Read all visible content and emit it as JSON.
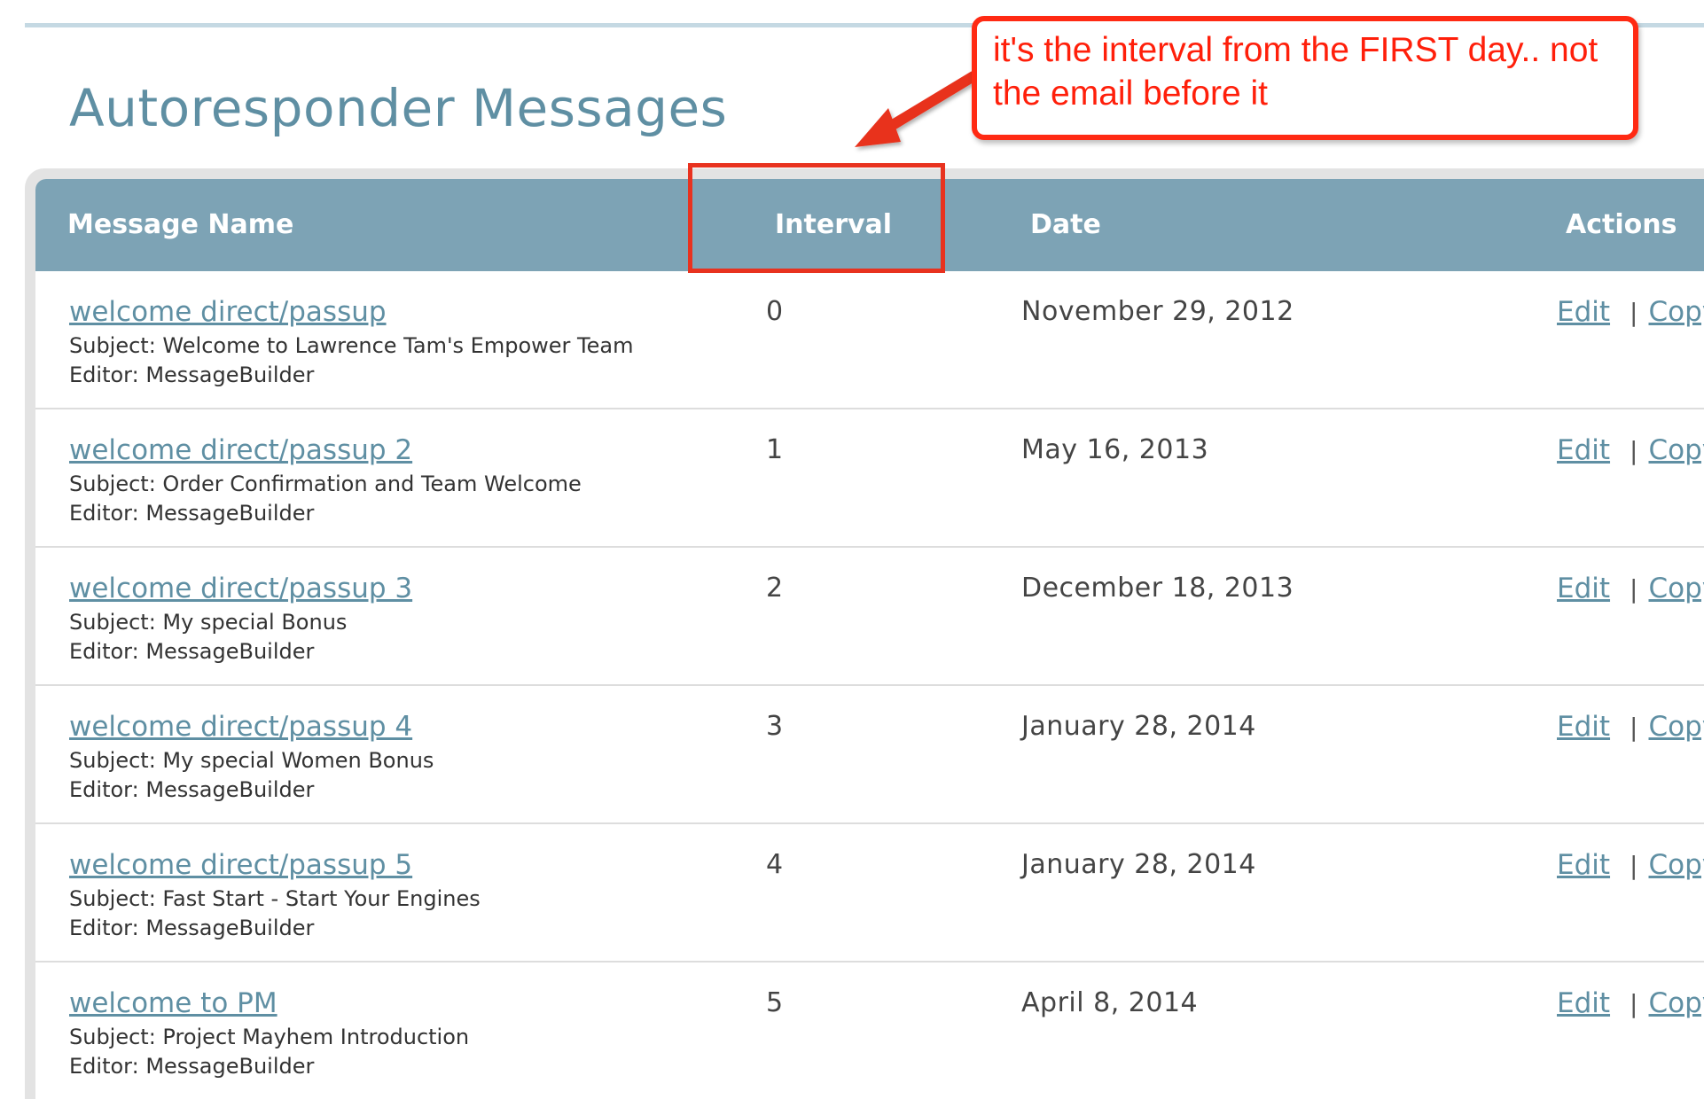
{
  "page": {
    "title": "Autoresponder Messages"
  },
  "table": {
    "headers": {
      "name": "Message Name",
      "interval": "Interval",
      "date": "Date",
      "actions": "Actions"
    },
    "action_labels": {
      "edit": "Edit",
      "separator": "|",
      "copy": "Copy"
    },
    "rows": [
      {
        "name": "welcome direct/passup",
        "subject": "Subject: Welcome to Lawrence Tam's Empower Team",
        "editor": "Editor: MessageBuilder",
        "interval": "0",
        "date": "November 29, 2012"
      },
      {
        "name": "welcome direct/passup 2",
        "subject": "Subject: Order Confirmation and Team Welcome",
        "editor": "Editor: MessageBuilder",
        "interval": "1",
        "date": "May 16, 2013"
      },
      {
        "name": "welcome direct/passup 3",
        "subject": "Subject: My special Bonus",
        "editor": "Editor: MessageBuilder",
        "interval": "2",
        "date": "December 18, 2013"
      },
      {
        "name": "welcome direct/passup 4",
        "subject": "Subject: My special Women Bonus",
        "editor": "Editor: MessageBuilder",
        "interval": "3",
        "date": "January 28, 2014"
      },
      {
        "name": "welcome direct/passup 5",
        "subject": "Subject: Fast Start - Start Your Engines",
        "editor": "Editor: MessageBuilder",
        "interval": "4",
        "date": "January 28, 2014"
      },
      {
        "name": "welcome to PM",
        "subject": "Subject: Project Mayhem Introduction",
        "editor": "Editor: MessageBuilder",
        "interval": "5",
        "date": "April 8, 2014"
      }
    ]
  },
  "annotation": {
    "text": "it's the interval from the FIRST day.. not the email before it",
    "color": "#ff2a13"
  },
  "colors": {
    "header_bg": "#7da3b5",
    "link": "#5f8fa3",
    "title": "#5f8fa3"
  }
}
